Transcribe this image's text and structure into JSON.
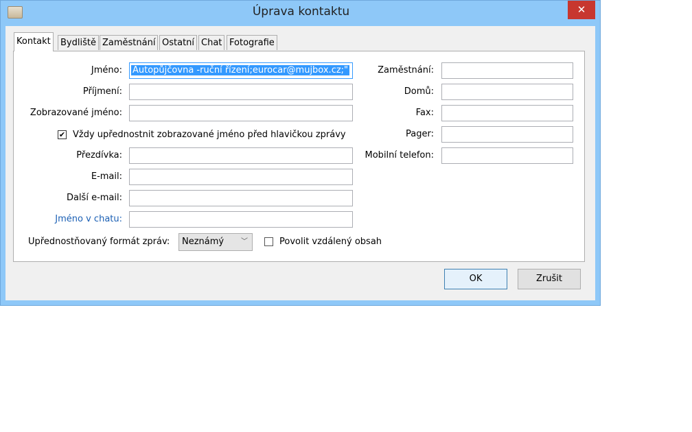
{
  "window": {
    "title": "Úprava kontaktu",
    "close": "✕"
  },
  "tabs": [
    "Kontakt",
    "Bydliště",
    "Zaměstnání",
    "Ostatní",
    "Chat",
    "Fotografie"
  ],
  "left": {
    "name_label": "Jméno:",
    "name_value": "Autopůjčovna -ruční řízení;eurocar@mujbox.cz;\"",
    "surname_label": "Příjmení:",
    "display_label": "Zobrazované jméno:",
    "prefer_display_label": "Vždy upřednostnit zobrazované jméno před hlavičkou zprávy",
    "prefer_display_checked": true,
    "nick_label": "Přezdívka:",
    "email_label": "E-mail:",
    "email2_label": "Další e-mail:",
    "chat_label": "Jméno v chatu:",
    "format_label": "Upřednostňovaný formát zpráv:",
    "format_value": "Neznámý",
    "remote_label": "Povolit vzdálený obsah",
    "remote_checked": false
  },
  "right": {
    "work": "Zaměstnání:",
    "home": "Domů:",
    "fax": "Fax:",
    "pager": "Pager:",
    "mobile": "Mobilní telefon:"
  },
  "buttons": {
    "ok": "OK",
    "cancel": "Zrušit"
  },
  "colors": {
    "titlebar": "#8ec8f8",
    "close": "#c7372f",
    "selection": "#3399ff",
    "link_label": "#1a5fb4"
  }
}
